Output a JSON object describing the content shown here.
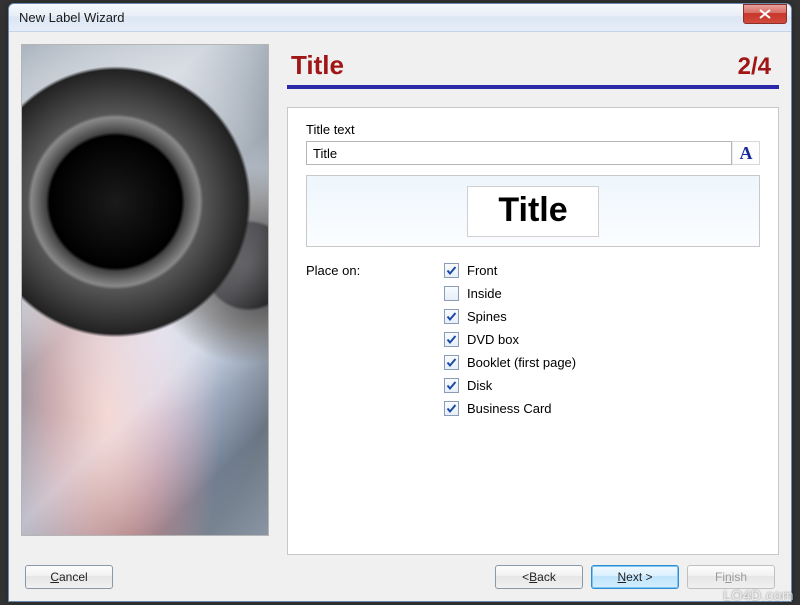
{
  "window": {
    "title": "New Label Wizard"
  },
  "step": {
    "title": "Title",
    "counter": "2/4"
  },
  "title_section": {
    "label": "Title text",
    "value": "Title",
    "font_button": "A",
    "preview": "Title"
  },
  "place_on": {
    "label": "Place on:",
    "options": [
      {
        "label": "Front",
        "checked": true
      },
      {
        "label": "Inside",
        "checked": false
      },
      {
        "label": "Spines",
        "checked": true
      },
      {
        "label": "DVD box",
        "checked": true
      },
      {
        "label": "Booklet (first page)",
        "checked": true
      },
      {
        "label": "Disk",
        "checked": true
      },
      {
        "label": "Business Card",
        "checked": true
      }
    ]
  },
  "buttons": {
    "cancel_pre": "",
    "cancel_u": "C",
    "cancel_post": "ancel",
    "back_pre": "<  ",
    "back_u": "B",
    "back_post": "ack",
    "next_pre": "",
    "next_u": "N",
    "next_post": "ext  >",
    "finish_pre": "Fi",
    "finish_u": "n",
    "finish_post": "ish"
  },
  "watermark": "LO4D.com"
}
